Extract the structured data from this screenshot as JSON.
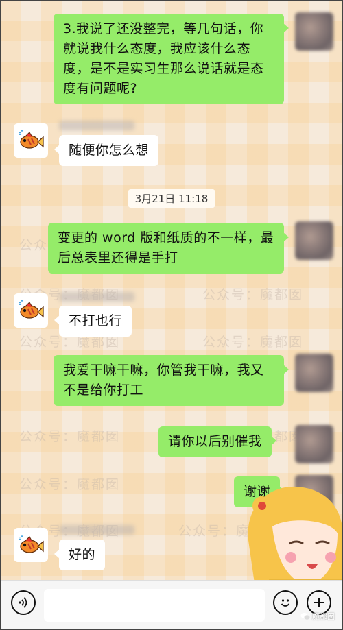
{
  "messages": [
    {
      "side": "right",
      "text": "3.我说了还没整完，等几句话，你就说我什么态度，我应该什么态度，是不是实习生那么说话就是态度有问题呢?"
    },
    {
      "side": "left",
      "text": "随便你怎么想"
    },
    {
      "side": "right",
      "text": "变更的 word 版和纸质的不一样，最后总表里还得是手打"
    },
    {
      "side": "left",
      "text": "不打也行"
    },
    {
      "side": "right",
      "text": "我爱干嘛干嘛，你管我干嘛，我又不是给你打工"
    },
    {
      "side": "right",
      "text": "请你以后别催我"
    },
    {
      "side": "right",
      "text": "谢谢"
    },
    {
      "side": "left",
      "text": "好的"
    }
  ],
  "timestamp": "3月21日 11:18",
  "watermark_text": "公众号：魔都囡",
  "logo_text": "魔都囡",
  "icons": {
    "voice": "voice-icon",
    "emoji": "emoji-icon",
    "plus": "plus-icon",
    "fish": "fish-avatar-icon"
  },
  "colors": {
    "self_bubble": "#95ec69",
    "other_bubble": "#ffffff"
  }
}
